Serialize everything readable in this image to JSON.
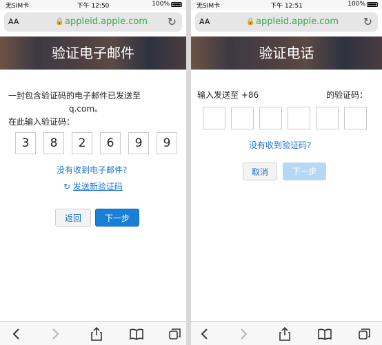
{
  "left": {
    "status": {
      "carrier": "无SIM卡",
      "time": "下午 12:50",
      "battery": "100%",
      "battery_level": 1.0
    },
    "address": {
      "text_size": "AA",
      "domain": "appleid.apple.com"
    },
    "banner_title": "验证电子邮件",
    "message_line1": "一封包含验证码的电子邮件已发送至",
    "message_email": "q.com。",
    "enter_label": "在此输入验证码：",
    "code_digits": [
      "3",
      "8",
      "2",
      "6",
      "9",
      "9"
    ],
    "no_email_link": "没有收到电子邮件?",
    "resend_link": "发送新验证码",
    "back_button": "返回",
    "next_button": "下一步"
  },
  "right": {
    "status": {
      "carrier": "无SIM卡",
      "time": "下午 12:51",
      "battery": "100%",
      "battery_level": 1.0
    },
    "address": {
      "text_size": "AA",
      "domain": "appleid.apple.com"
    },
    "banner_title": "验证电话",
    "sent_to_prefix": "输入发送至 +86",
    "sent_to_suffix": "的验证码：",
    "no_code_link": "没有收到验证码?",
    "cancel_button": "取消",
    "next_button": "下一步"
  },
  "colors": {
    "accent": "#1a73cf",
    "secure_green": "#2fa84f",
    "primary_button": "#1a7fd6",
    "disabled_button": "#b7d8f5"
  }
}
